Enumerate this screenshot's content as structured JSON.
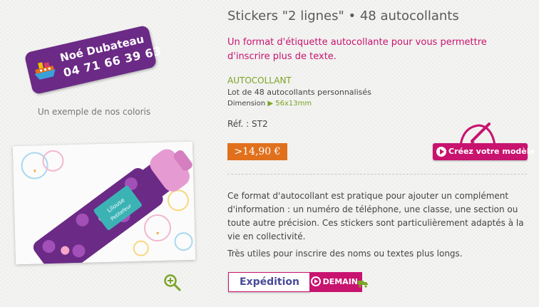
{
  "product": {
    "title": "Stickers \"2 lignes\" • 48 autocollants",
    "intro": "Un format d'étiquette autocollante pour vous permettre d'inscrire plus de texte.",
    "type_label": "AUTOCOLLANT",
    "type_desc": "Lot de 48 autocollants personnalisés",
    "dimension_label": "Dimension",
    "dimension_value": "56x13mm",
    "ref_label": "Réf. :",
    "ref_value": "ST2",
    "price": ">14,90 €",
    "create_button": "Créez votre modèle",
    "description": "Ce format d'autocollant est pratique pour ajouter un complément d'information : un numéro de téléphone, une classe, une section ou toute autre précision. Ces stickers sont particulièrement adaptés à la vie en collectivité.",
    "description2": "Très utiles pour inscrire des noms ou textes plus longs.",
    "shipping_label": "Expédition",
    "shipping_when": "DEMAIN"
  },
  "sample_label": {
    "name": "Noé Dubateau",
    "phone": "04 71 66 39 63"
  },
  "gallery": {
    "caption": "Un exemple de nos coloris",
    "bottle_label_line1": "Lilouse",
    "bottle_label_line2": "Petitefeur"
  },
  "icons": {
    "zoom": "zoom-in-icon",
    "play": "play-circle-icon",
    "truck": "truck-icon",
    "boat": "boat-icon",
    "pen": "pen-icon"
  },
  "colors": {
    "brand_magenta": "#c8136f",
    "label_purple": "#6b2a86",
    "price_orange": "#e0701c",
    "accent_green": "#7aa425"
  }
}
